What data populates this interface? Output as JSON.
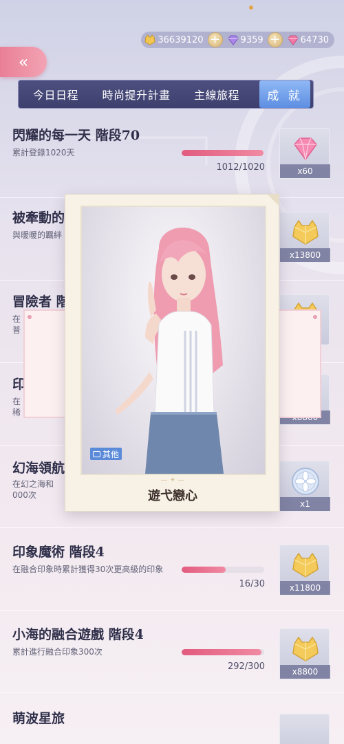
{
  "currency": {
    "items": [
      {
        "icon": "gold-cat-coin-icon",
        "value": "36639120"
      },
      {
        "icon": "purple-gem-icon",
        "value": "9359"
      },
      {
        "icon": "pink-gem-icon",
        "value": "64730"
      }
    ],
    "plus_label": "+"
  },
  "nav": {
    "back_label": "«",
    "tabs": [
      {
        "label": "今日日程"
      },
      {
        "label": "時尚提升計畫"
      },
      {
        "label": "主線旅程"
      },
      {
        "label": "成 就"
      }
    ]
  },
  "achievements": [
    {
      "title": "閃耀的每一天 階段70",
      "desc": "累計登錄1020天",
      "progress_text": "1012/1020",
      "progress": 0.99,
      "reward_icon": "pink-diamond-icon",
      "reward_qty": "x60"
    },
    {
      "title": "被牽動的心",
      "desc": "與暖暖的羈絆",
      "reward_icon": "gold-cat-coin-icon",
      "reward_qty": "x13800"
    },
    {
      "title": "冒險者 階",
      "desc": "在",
      "desc2": "普",
      "reward_icon": "gold-cat-coin-icon"
    },
    {
      "title": "印",
      "desc": "在",
      "desc2": "稀",
      "reward_icon": "gold-cat-coin-icon",
      "reward_qty": "x8800"
    },
    {
      "title": "幻海領航",
      "desc": "在幻之海和",
      "desc2": "000次",
      "reward_icon": "silver-flower-coin-icon",
      "reward_qty": "x1"
    },
    {
      "title": "印象魔術 階段4",
      "desc": "在融合印象時累計獲得30次更高級的印象",
      "progress_text": "16/30",
      "progress": 0.53,
      "reward_icon": "gold-cat-coin-icon",
      "reward_qty": "x11800"
    },
    {
      "title": "小海的融合遊戲 階段4",
      "desc": "累計進行融合印象300次",
      "progress_text": "292/300",
      "progress": 0.97,
      "reward_icon": "gold-cat-coin-icon",
      "reward_qty": "x8800"
    },
    {
      "title": "萌波星旅"
    }
  ],
  "popup": {
    "badge_label": "其他",
    "caption": "遊弋戀心",
    "ornament": "— ✦ —"
  }
}
